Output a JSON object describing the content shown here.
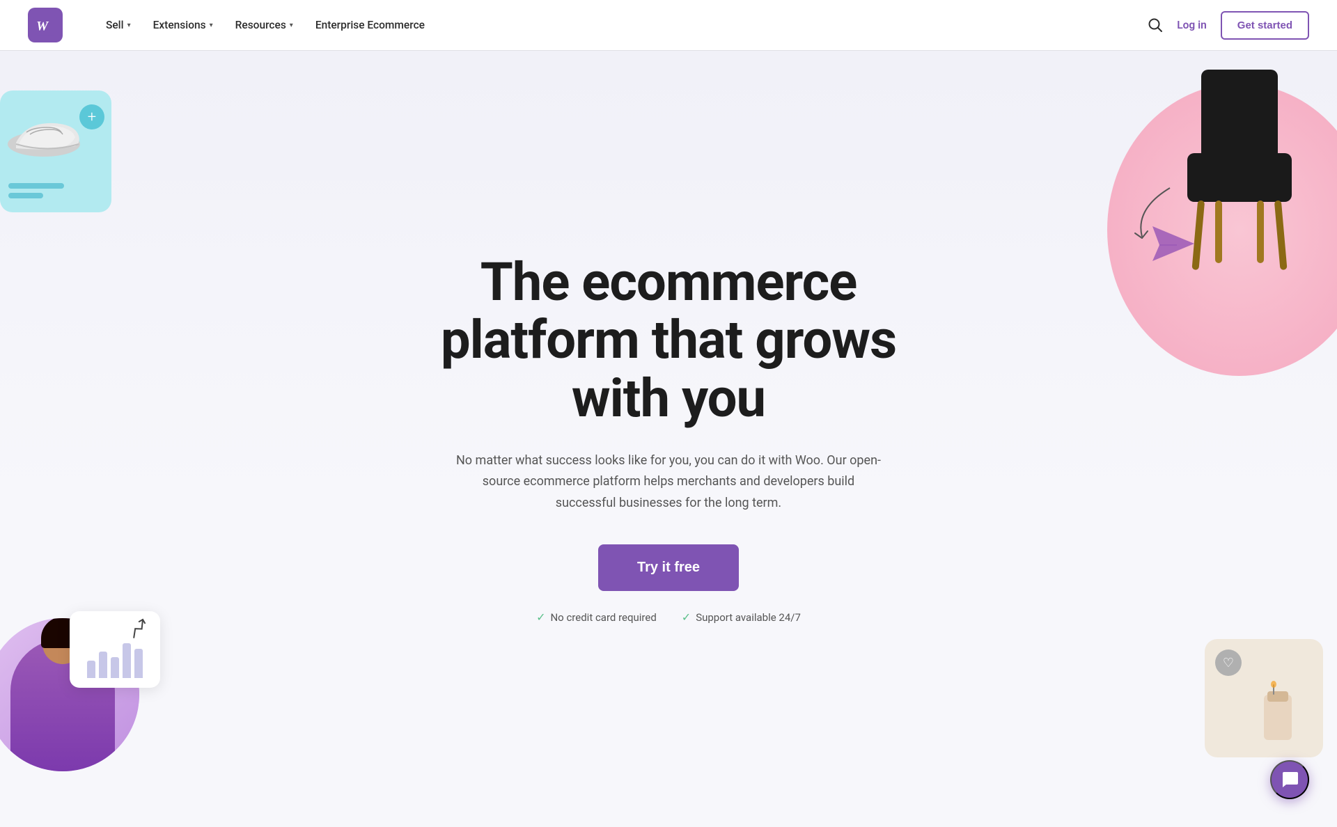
{
  "nav": {
    "logo_text": "Woo",
    "links": [
      {
        "label": "Sell",
        "has_dropdown": true
      },
      {
        "label": "Extensions",
        "has_dropdown": true
      },
      {
        "label": "Resources",
        "has_dropdown": true
      },
      {
        "label": "Enterprise Ecommerce",
        "has_dropdown": false
      }
    ],
    "login_label": "Log in",
    "get_started_label": "Get started"
  },
  "hero": {
    "title_line1": "The ecommerce",
    "title_line2": "platform that grows",
    "title_line3": "with you",
    "subtitle": "No matter what success looks like for you, you can do it with Woo. Our open-source ecommerce platform helps merchants and developers build successful businesses for the long term.",
    "cta_label": "Try it free",
    "badge1": "No credit card required",
    "badge2": "Support available 24/7"
  },
  "colors": {
    "brand_purple": "#7f54b3",
    "text_dark": "#1d1d1d",
    "text_muted": "#555555",
    "check_green": "#5bc08a",
    "bg_light": "#f0f0f8"
  },
  "chat": {
    "icon": "💬"
  }
}
